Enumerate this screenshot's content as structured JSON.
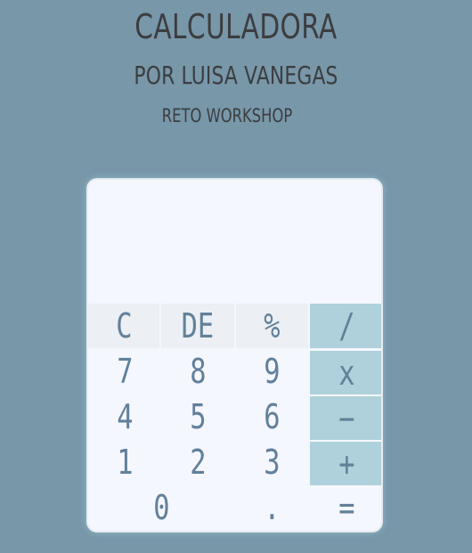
{
  "header": {
    "title": "CALCULADORA",
    "subtitle": "POR LUISA VANEGAS",
    "tagline": "RETO WORKSHOP"
  },
  "calculator": {
    "display_value": "",
    "keys": {
      "clear": "C",
      "delete": "DE",
      "percent": "%",
      "divide": "/",
      "seven": "7",
      "eight": "8",
      "nine": "9",
      "multiply": "x",
      "four": "4",
      "five": "5",
      "six": "6",
      "subtract": "−",
      "one": "1",
      "two": "2",
      "three": "3",
      "add": "+",
      "zero": "0",
      "decimal": ".",
      "equals": "="
    }
  },
  "colors": {
    "background": "#7897a9",
    "title_text": "#3b3d40",
    "calculator_body": "#f5f7fe",
    "function_key": "#eceff3",
    "operator_key": "#aed1db",
    "key_text": "#61809a"
  }
}
